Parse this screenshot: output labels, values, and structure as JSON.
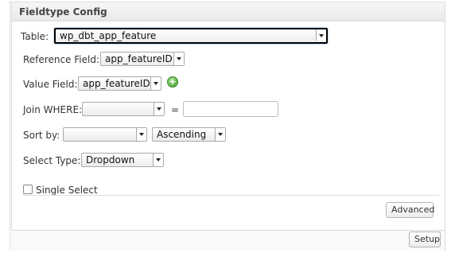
{
  "panel": {
    "title": "Fieldtype Config"
  },
  "table": {
    "label": "Table:",
    "value": "wp_dbt_app_feature"
  },
  "reference_field": {
    "label": "Reference Field:",
    "value": "app_featureID"
  },
  "value_field": {
    "label": "Value Field:",
    "value": "app_featureID",
    "add_icon": "plus-circle-icon"
  },
  "join_where": {
    "label": "Join WHERE:",
    "select_value": "",
    "operator": "=",
    "input_value": ""
  },
  "sort_by": {
    "label": "Sort by:",
    "field_value": "",
    "order_value": "Ascending"
  },
  "select_type": {
    "label": "Select Type:",
    "value": "Dropdown"
  },
  "single_select": {
    "label": "Single Select",
    "checked": false
  },
  "buttons": {
    "advanced": "Advanced",
    "setup": "Setup"
  },
  "colors": {
    "add_icon": "#4caf3a",
    "panel_border": "#dcdcdc"
  }
}
